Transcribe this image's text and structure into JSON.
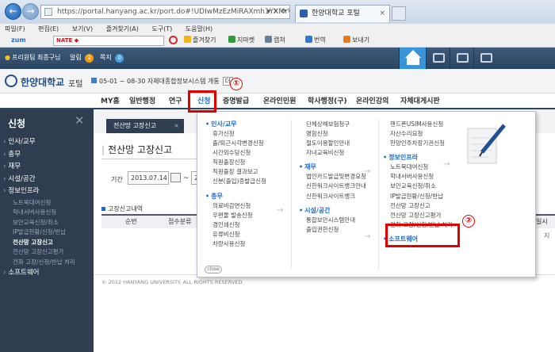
{
  "browser": {
    "url": "https://portal.hanyang.ac.kr/port.do#!UDIwMzEzMiRAXmh1YXMrVjBEeMCRAXk0wMDC",
    "tab_title": "한양대학교 포털",
    "menu": [
      "파일(F)",
      "편집(E)",
      "보기(V)",
      "즐겨찾기(A)",
      "도구(T)",
      "도움말(H)"
    ],
    "toolbar": {
      "brand": "zum",
      "search_value": "NATE ◆",
      "items": [
        "즐겨찾기",
        "지마켓",
        "캡쳐",
        "번역",
        "보내기"
      ]
    }
  },
  "portal_top": {
    "user": "프리원팀 최종구님",
    "alarm_label": "알림",
    "alarm_count": "2",
    "note_label": "쪽지",
    "note_count": "0"
  },
  "header": {
    "logo": "한양대학교",
    "portal_label": "포털",
    "ticker": "05-01 ~ 08-30 자체대종합정보시스템 개통",
    "ticker_more": "더"
  },
  "gnb": [
    "MY홈",
    "일반행정",
    "연구",
    "신청",
    "증명발급",
    "온라인민원",
    "학사행정(구)",
    "온라인강의",
    "자체대게시판"
  ],
  "sidebar": {
    "title": "신청",
    "items": [
      {
        "label": "인사/교무",
        "type": "top"
      },
      {
        "label": "총무",
        "type": "top"
      },
      {
        "label": "재무",
        "type": "top"
      },
      {
        "label": "시설/공간",
        "type": "top"
      },
      {
        "label": "정보인프라",
        "type": "open"
      },
      {
        "label": "노트북대여신청",
        "type": "sub"
      },
      {
        "label": "학내서버사용신청",
        "type": "sub"
      },
      {
        "label": "보안교육신청/취소",
        "type": "sub"
      },
      {
        "label": "IP발급현황/신청/반납",
        "type": "sub"
      },
      {
        "label": "전산망 고장신고",
        "type": "sub-on"
      },
      {
        "label": "전산망 고장신고평가",
        "type": "sub"
      },
      {
        "label": "전화 고장/신청/반납 처리",
        "type": "sub"
      },
      {
        "label": "소프트웨어",
        "type": "top"
      }
    ]
  },
  "content": {
    "tab_label": "전산망 고장신고",
    "title": "전산망 고장신고",
    "period_label": "기간",
    "date_from": "2013.07.14",
    "tilde": "~",
    "date_to": "201",
    "list_title": "고장신고내역",
    "columns": [
      "순번",
      "접수분류"
    ],
    "right_col": "일시",
    "right_val": "지",
    "footer": "© 2012 HANYANG UNIVERSITY. ALL RIGHTS RESERVED."
  },
  "dropdown": {
    "col1": [
      {
        "cat": "인사/교무",
        "items": [
          "휴가신청",
          "출/퇴근시각변경신청",
          "시간외수당신청",
          "직원출장신청",
          "직원출장 결과보고",
          "신분(출입)증발급신청"
        ]
      },
      {
        "cat": "총무",
        "items": [
          "의료비감면신청",
          "우편물 발송신청",
          "경인쇄신청",
          "유류비신청",
          "차량사용신청"
        ]
      }
    ],
    "col2": [
      {
        "cat": "",
        "items": [
          "단체상해보험청구",
          "명함신청",
          "철도이용할인안내",
          "자녀교육비신청"
        ]
      },
      {
        "cat": "재무",
        "items": [
          "법인카드발급및변경요청",
          "신한워크사이트뱅크안내",
          "신한워크사이트뱅크"
        ]
      },
      {
        "cat": "시설/공간",
        "items": [
          "통합보안시스템안내",
          "출입권한신청"
        ]
      }
    ],
    "col3": [
      {
        "cat": "",
        "items": [
          "핸드폰USIM사용신청",
          "자산수리요청",
          "한양인주차장기권신청"
        ]
      },
      {
        "cat": "정보인프라",
        "items": [
          "노트북대여신청",
          "학내서버사용신청",
          "보안교육신청/취소",
          "IP발급현황/신청/반납",
          "전산망 고장신고",
          "전산망 고장신고평가",
          "전화 고장/신청/반납 처리"
        ]
      },
      {
        "cat": "소프트웨어",
        "items": []
      }
    ],
    "close_label": "close"
  },
  "annotations": {
    "one": "①",
    "two": "②"
  },
  "colors": {
    "accent": "#1a6ad0",
    "sidebar": "#2e3d4f",
    "annotation": "#e10000"
  }
}
